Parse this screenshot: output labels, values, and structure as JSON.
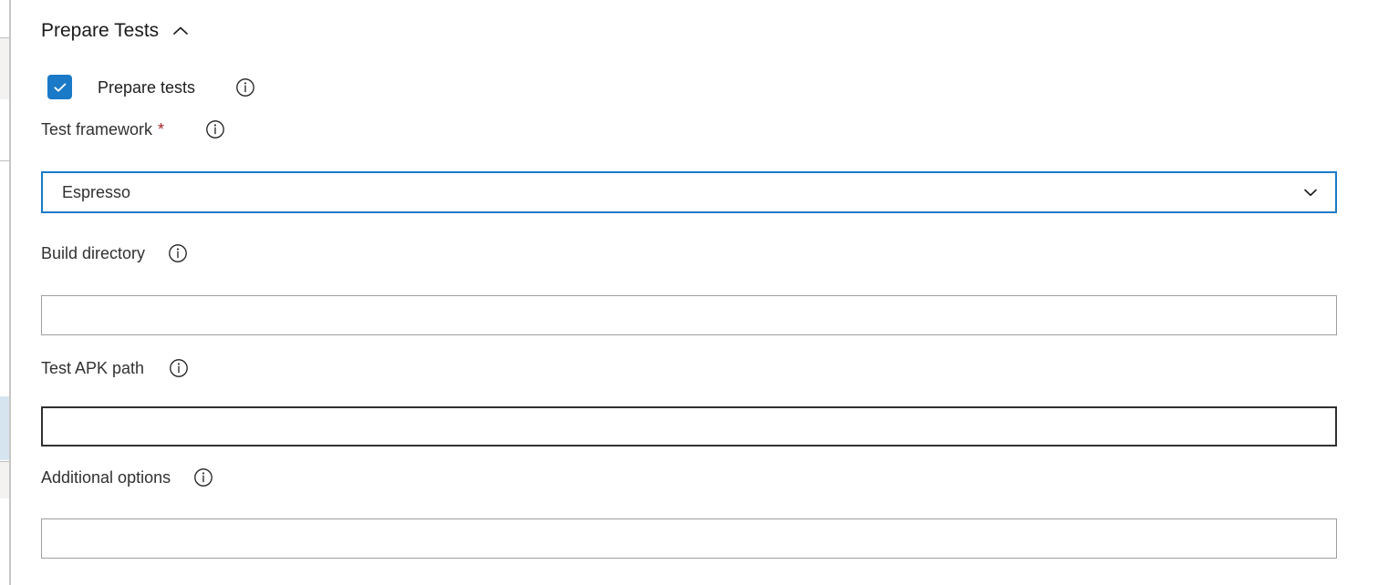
{
  "section": {
    "title": "Prepare Tests",
    "collapse_icon": "chevron-up-icon",
    "expanded": true
  },
  "colors": {
    "accent": "#1b7ac7",
    "required_asterisk": "#a4262c",
    "input_border": "#a19f9d",
    "input_border_hover": "#323130",
    "text": "#201f1e",
    "rail_highlight": "#d6e4f0"
  },
  "prepare_tests_checkbox": {
    "label": "Prepare tests",
    "checked": true,
    "info_icon": "info-icon"
  },
  "fields": {
    "test_framework": {
      "label": "Test framework",
      "required": true,
      "required_marker": "*",
      "info_icon": "info-icon",
      "control": "dropdown",
      "value": "Espresso",
      "caret_icon": "chevron-down-icon",
      "options": [
        "Espresso"
      ]
    },
    "build_directory": {
      "label": "Build directory",
      "required": false,
      "info_icon": "info-icon",
      "control": "text",
      "value": "",
      "placeholder": ""
    },
    "test_apk_path": {
      "label": "Test APK path",
      "required": false,
      "info_icon": "info-icon",
      "control": "text",
      "value": "",
      "placeholder": "",
      "state": "hovered"
    },
    "additional_options": {
      "label": "Additional options",
      "required": false,
      "info_icon": "info-icon",
      "control": "text",
      "value": "",
      "placeholder": ""
    }
  }
}
